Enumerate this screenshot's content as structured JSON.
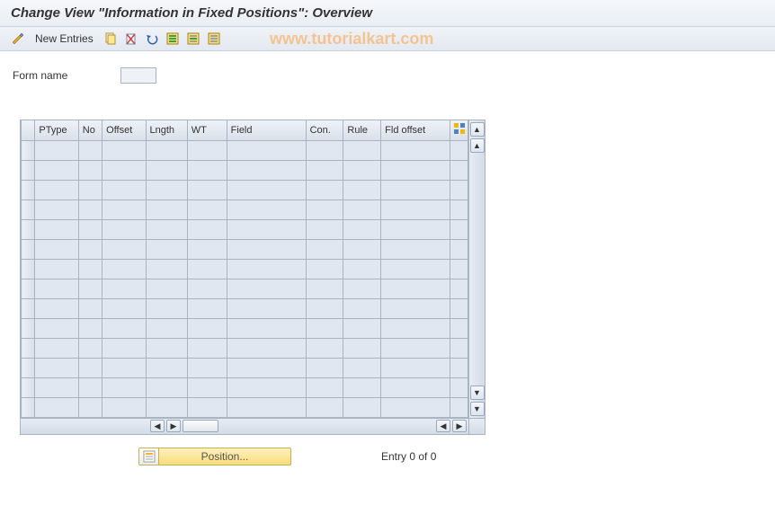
{
  "title": "Change View \"Information in Fixed Positions\": Overview",
  "watermark": "www.tutorialkart.com",
  "toolbar": {
    "new_entries_label": "New Entries"
  },
  "form": {
    "form_name_label": "Form name",
    "form_name_value": ""
  },
  "table": {
    "columns": [
      "PType",
      "No",
      "Offset",
      "Lngth",
      "WT",
      "Field",
      "Con.",
      "Rule",
      "Fld offset"
    ],
    "rows": 14
  },
  "footer": {
    "position_label": "Position...",
    "entry_text": "Entry 0 of 0"
  }
}
